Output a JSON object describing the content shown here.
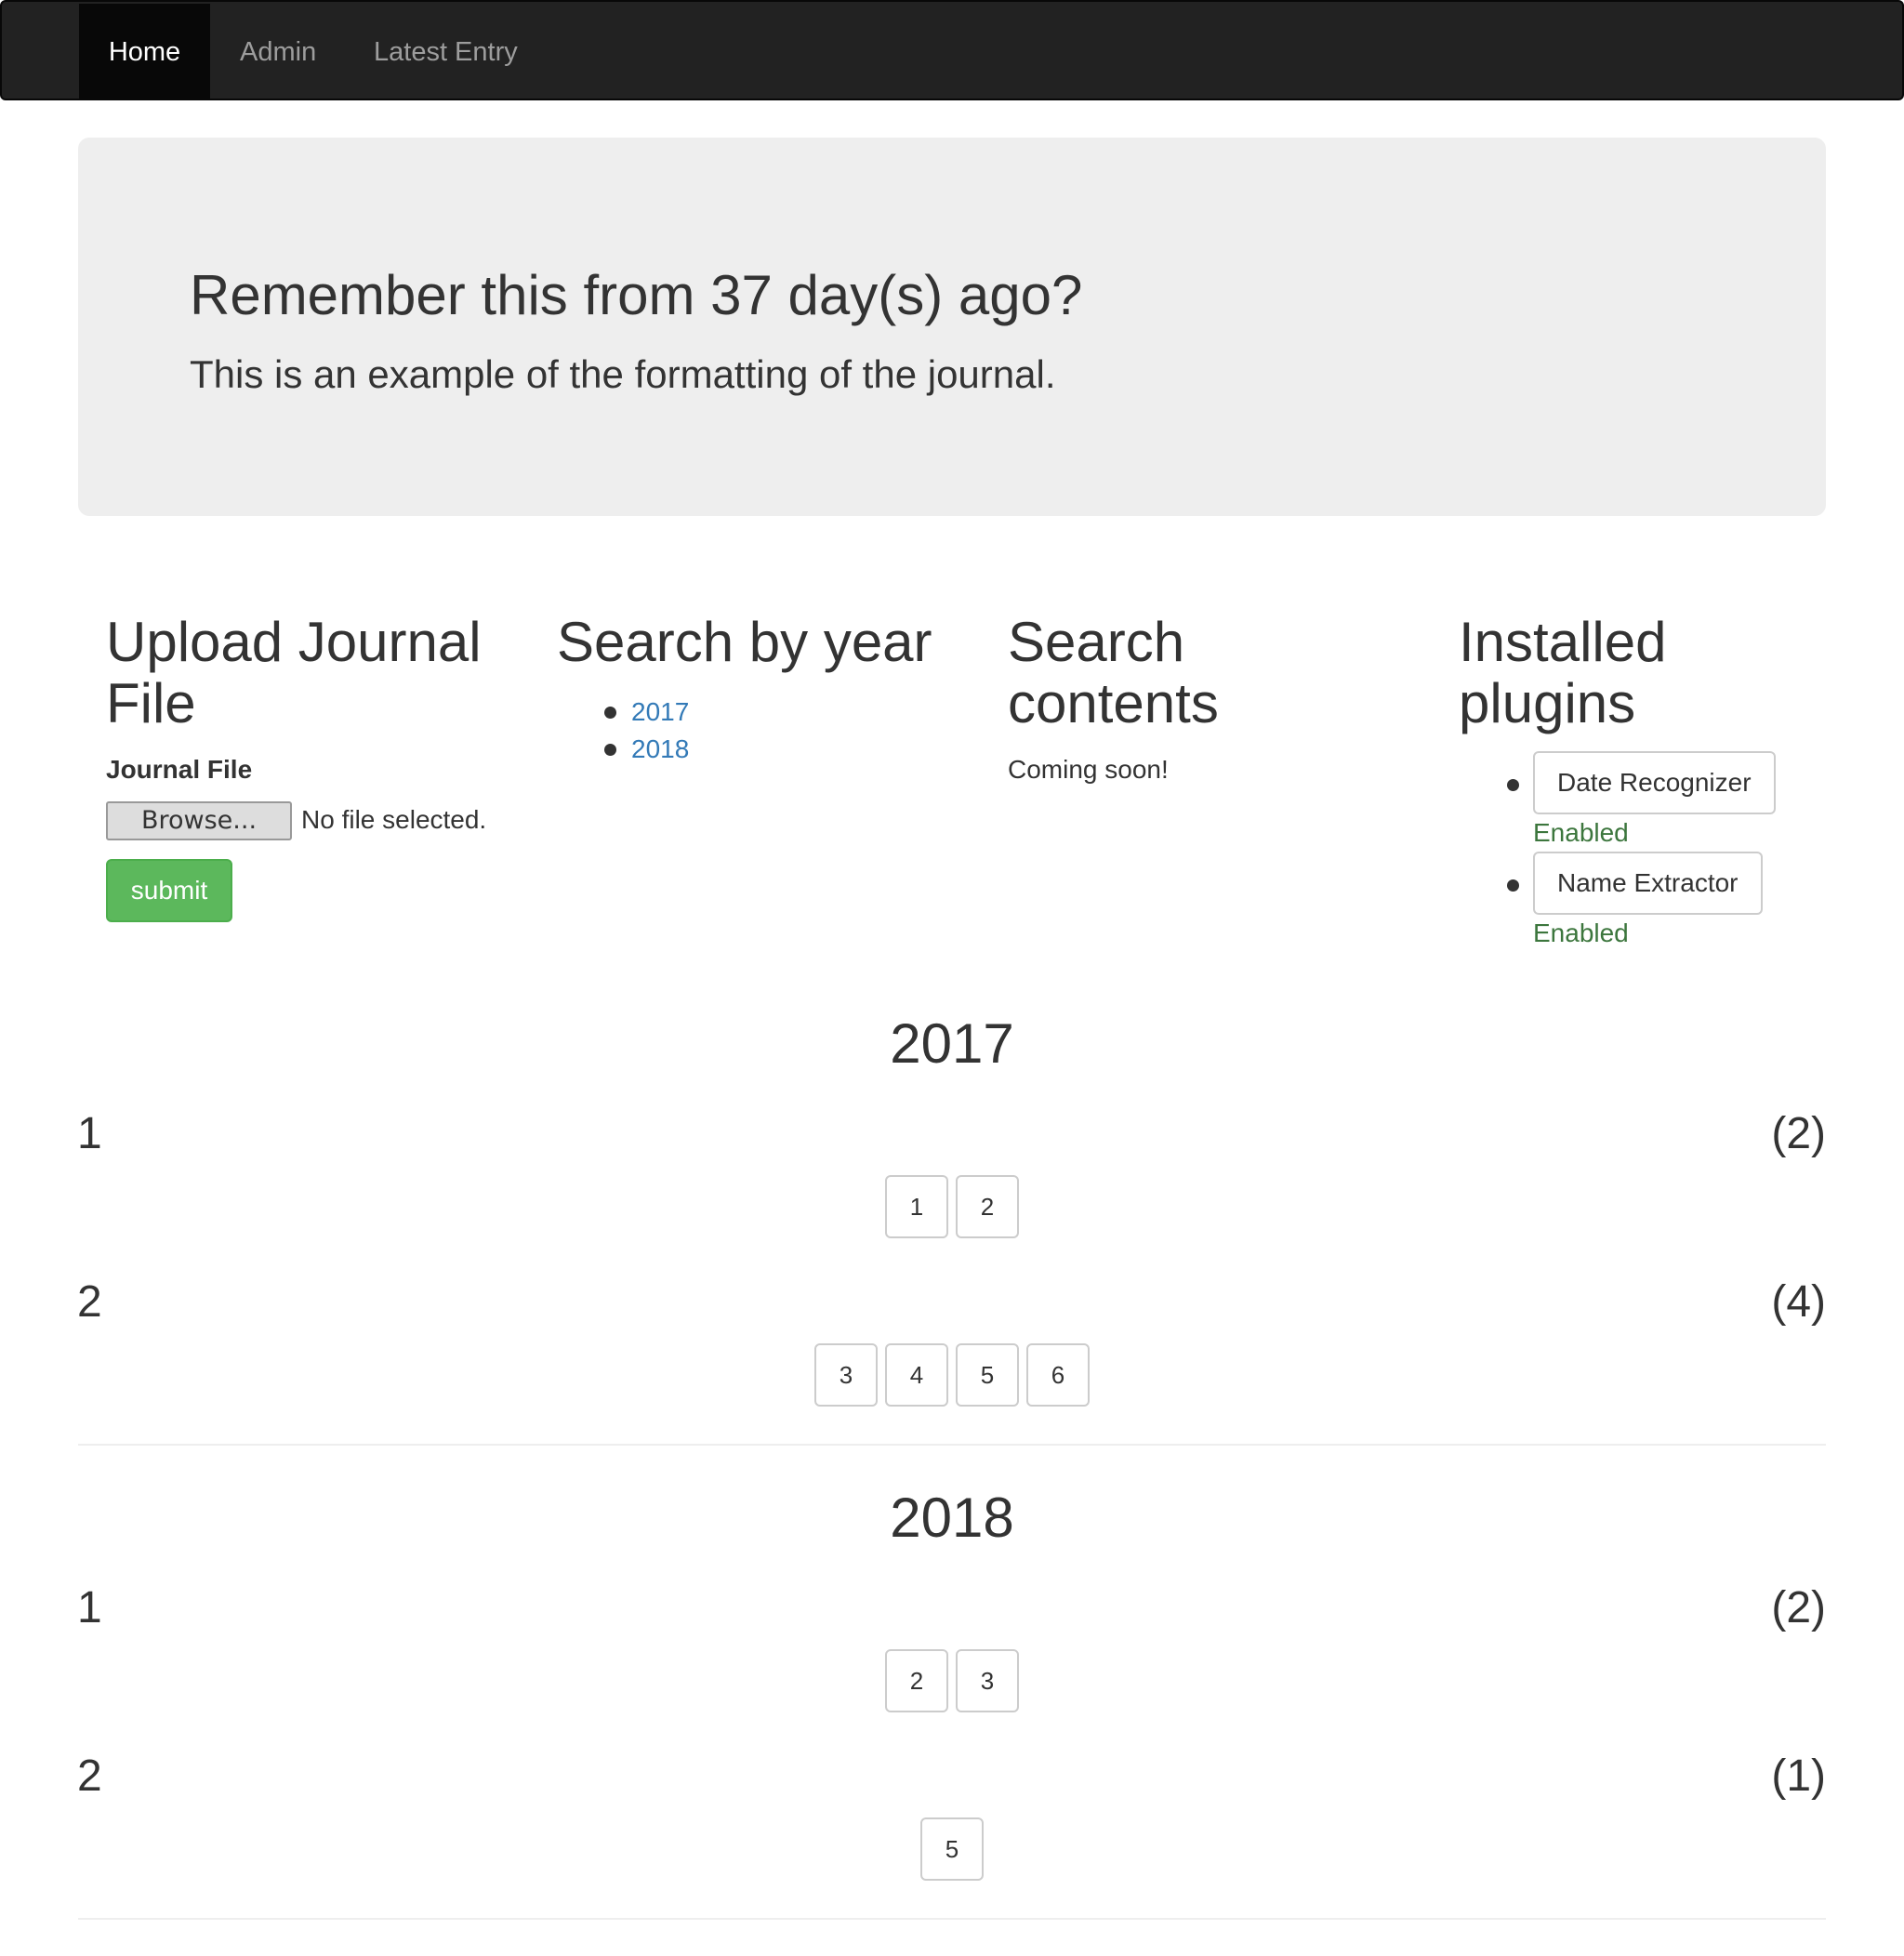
{
  "nav": {
    "items": [
      {
        "label": "Home",
        "active": true
      },
      {
        "label": "Admin",
        "active": false
      },
      {
        "label": "Latest Entry",
        "active": false
      }
    ]
  },
  "jumbotron": {
    "title": "Remember this from 37 day(s) ago?",
    "text": "This is an example of the formatting of the journal."
  },
  "upload": {
    "heading_line1": "Upload Journal",
    "heading_line2": "File",
    "field_label": "Journal File",
    "browse_label": "Browse...",
    "file_status": "No file selected.",
    "submit_label": "submit"
  },
  "search_year": {
    "heading": "Search by year",
    "years": [
      "2017",
      "2018"
    ]
  },
  "search_contents": {
    "heading_line1": "Search",
    "heading_line2": "contents",
    "text": "Coming soon!"
  },
  "plugins": {
    "heading_line1": "Installed",
    "heading_line2": "plugins",
    "items": [
      {
        "name": "Date Recognizer",
        "status": "Enabled"
      },
      {
        "name": "Name Extractor",
        "status": "Enabled"
      }
    ]
  },
  "archive": [
    {
      "year": "2017",
      "months": [
        {
          "month": "1",
          "count": "(2)",
          "days": [
            "1",
            "2"
          ]
        },
        {
          "month": "2",
          "count": "(4)",
          "days": [
            "3",
            "4",
            "5",
            "6"
          ]
        }
      ]
    },
    {
      "year": "2018",
      "months": [
        {
          "month": "1",
          "count": "(2)",
          "days": [
            "2",
            "3"
          ]
        },
        {
          "month": "2",
          "count": "(1)",
          "days": [
            "5"
          ]
        }
      ]
    }
  ],
  "colors": {
    "navbar_bg": "#222222",
    "nav_active_bg": "#080808",
    "jumbotron_bg": "#eeeeee",
    "link": "#337ab7",
    "success": "#5cb85c",
    "enabled_text": "#3c763d"
  }
}
